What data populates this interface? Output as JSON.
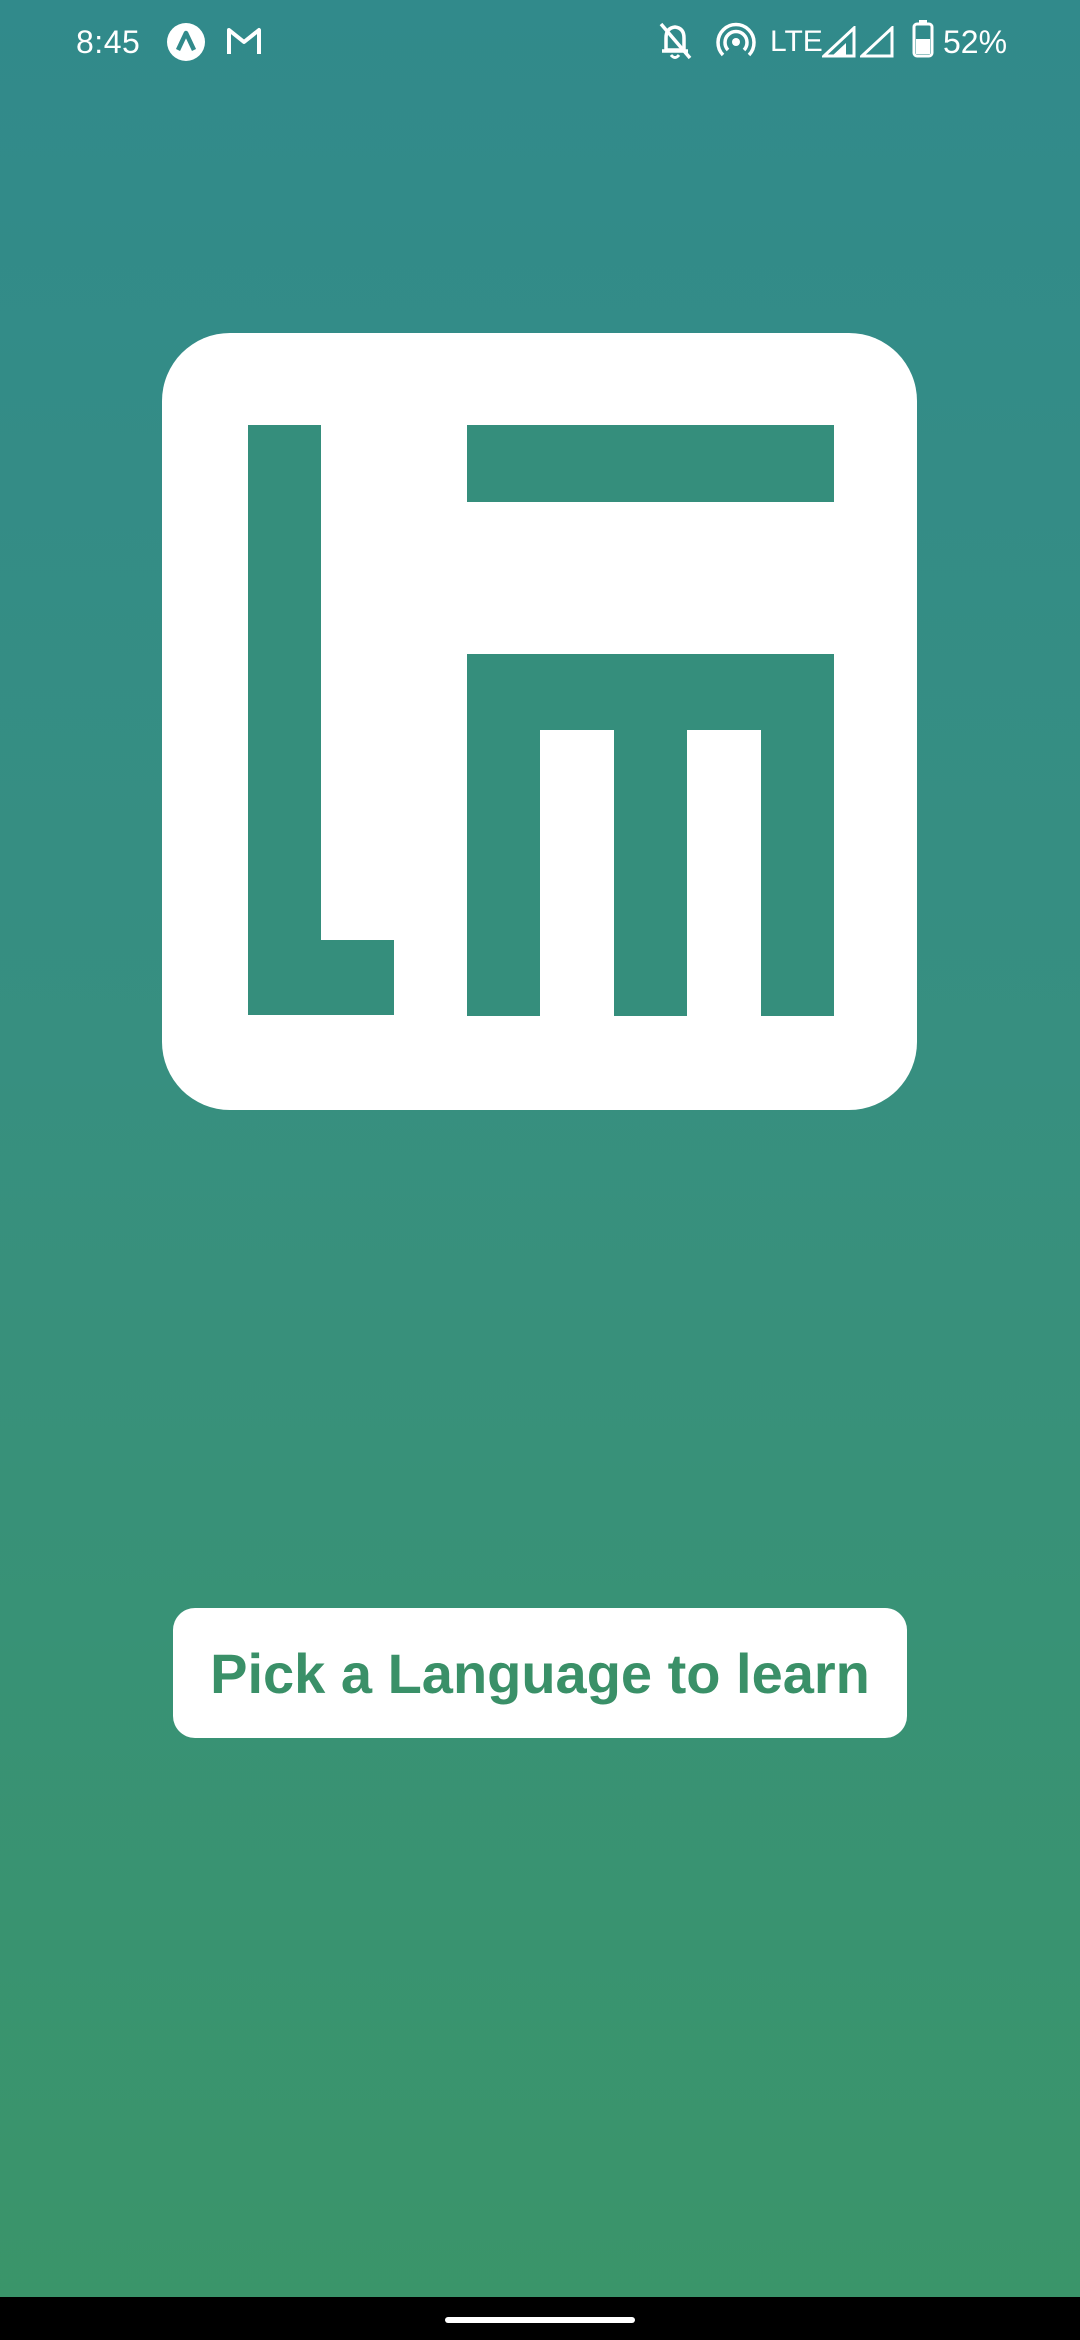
{
  "status_bar": {
    "time": "8:45",
    "network": "LTE",
    "battery": "52%",
    "icons": [
      "app-a-icon",
      "gmail-icon",
      "notifications-off-icon",
      "hotspot-icon",
      "signal-icon",
      "signal-icon",
      "battery-icon"
    ]
  },
  "main": {
    "logo_icon": "language-app-logo",
    "button_label": "Pick a Language to learn"
  },
  "colors": {
    "gradient_top": "#318a8b",
    "gradient_bottom": "#3a9569",
    "logo_fill": "#358e7c",
    "button_text": "#3a9068"
  }
}
